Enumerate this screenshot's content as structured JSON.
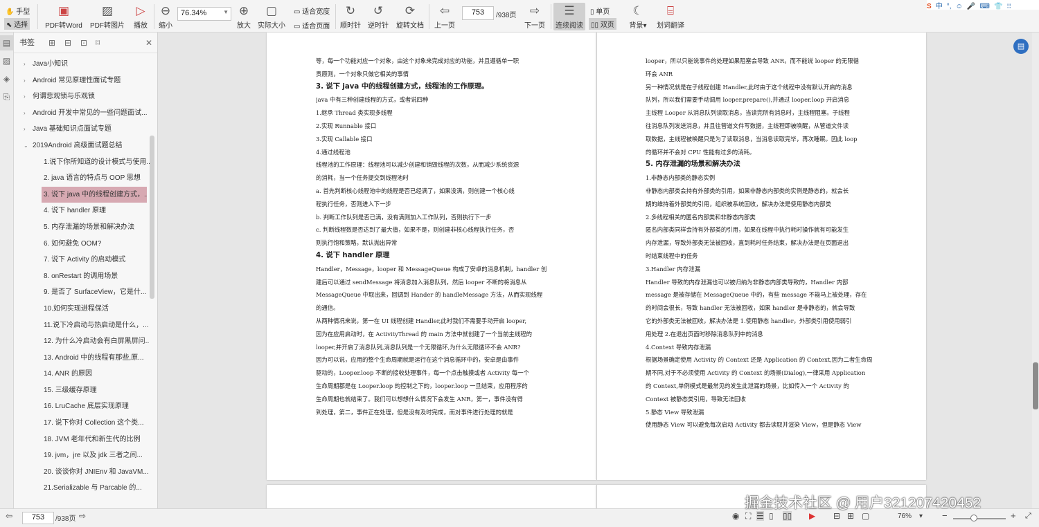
{
  "toolbar": {
    "hand_label": "手型",
    "select_label": "选择",
    "pdf_to_word": "PDF转Word",
    "pdf_to_image": "PDF转图片",
    "play": "播放",
    "zoom_out": "缩小",
    "zoom_value": "76.34%",
    "zoom_in": "放大",
    "actual_size": "实际大小",
    "fit_width": "适合宽度",
    "fit_page": "适合页面",
    "rotate_cw": "顺时针",
    "rotate_ccw": "逆时针",
    "rotate_doc": "旋转文档",
    "prev_page": "上一页",
    "page_current": "753",
    "page_total": "/938页",
    "next_page": "下一页",
    "continuous": "连续阅读",
    "single": "单页",
    "double": "双页",
    "background": "背景",
    "translate": "划词翻译"
  },
  "tray": [
    "中",
    "°,",
    "☺",
    "🎤",
    "⌨",
    "👕",
    "⁝⁝"
  ],
  "sidebar": {
    "title": "书签",
    "items": [
      {
        "label": "Java小知识",
        "level": 0
      },
      {
        "label": "Android 常见原理性面试专题",
        "level": 0
      },
      {
        "label": "何谓悲观锁与乐观锁",
        "level": 0
      },
      {
        "label": "Android 开发中常见的一些问题面试...",
        "level": 0
      },
      {
        "label": "Java 基础知识点面试专题",
        "level": 0
      },
      {
        "label": "2019Android 高级面试题总结",
        "level": 0
      },
      {
        "label": "1.说下你所知道的设计模式与使用...",
        "level": 1
      },
      {
        "label": "2. java 语言的特点与 OOP 思想",
        "level": 1
      },
      {
        "label": "3. 说下 java 中的线程创建方式，...",
        "level": 1,
        "selected": true
      },
      {
        "label": "4. 说下 handler 原理",
        "level": 1
      },
      {
        "label": "5. 内存泄漏的场景和解决办法",
        "level": 1
      },
      {
        "label": "6. 如何避免 OOM?",
        "level": 1
      },
      {
        "label": "7. 说下 Activity 的启动模式",
        "level": 1
      },
      {
        "label": "8. onRestart 的调用场景",
        "level": 1
      },
      {
        "label": "9. 是否了 SurfaceView，它是什...",
        "level": 1
      },
      {
        "label": "10.如何实现进程保活",
        "level": 1
      },
      {
        "label": "11.说下冷启动与热启动是什么，...",
        "level": 1
      },
      {
        "label": "12. 为什么冷启动会有白屏黑屏问...",
        "level": 1
      },
      {
        "label": "13. Android 中的线程有那些,原...",
        "level": 1
      },
      {
        "label": "14. ANR 的原因",
        "level": 1
      },
      {
        "label": "15. 三级缓存原理",
        "level": 1
      },
      {
        "label": "16. LruCache 底层实现原理",
        "level": 1
      },
      {
        "label": "17. 说下你对 Collection 这个类...",
        "level": 1
      },
      {
        "label": "18. JVM 老年代和新生代的比例",
        "level": 1
      },
      {
        "label": "19. jvm，jre 以及 jdk 三者之间...",
        "level": 1
      },
      {
        "label": "20. 谈谈你对 JNIEnv 和 JavaVM...",
        "level": 1
      },
      {
        "label": "21.Serializable 与 Parcable 的...",
        "level": 1
      }
    ]
  },
  "page_left": [
    {
      "t": "等，每一个功能对应一个对象，由这个对象来完成对应的功能，并且遵循单一职",
      "h": false
    },
    {
      "t": "责原则，一个对象只做它相关的事情",
      "h": false
    },
    {
      "t": "3.  说下 java 中的线程创建方式，线程池的工作原理。",
      "h": true
    },
    {
      "t": "java 中有三种创建线程的方式，或者说四种",
      "h": false
    },
    {
      "t": "1.继承 Thread 类实现多线程",
      "h": false
    },
    {
      "t": "2.实现 Runnable 接口",
      "h": false
    },
    {
      "t": "3.实现 Callable 接口",
      "h": false
    },
    {
      "t": "4.通过线程池",
      "h": false
    },
    {
      "t": "线程池的工作原理：线程池可以减少创建和销毁线程的次数，从而减少系统资源",
      "h": false
    },
    {
      "t": "的消耗，当一个任务提交到线程池时",
      "h": false
    },
    {
      "t": "a. 首先判断核心线程池中的线程是否已经满了，如果没满，则创建一个核心线",
      "h": false
    },
    {
      "t": "程执行任务，否则进入下一步",
      "h": false
    },
    {
      "t": "b. 判断工作队列是否已满，没有满则加入工作队列，否则执行下一步",
      "h": false
    },
    {
      "t": "c. 判断线程数是否达到了最大值，如果不是，则创建非核心线程执行任务，否",
      "h": false
    },
    {
      "t": "则执行饱和策略，默认抛出异常",
      "h": false
    },
    {
      "t": "4.  说下 handler 原理",
      "h": true
    },
    {
      "t": "Handler，Message，looper 和 MessageQueue 构成了安卓的消息机制，handler 创",
      "h": false
    },
    {
      "t": "建后可以通过 sendMessage 将消息加入消息队列，然后 looper 不断的将消息从",
      "h": false
    },
    {
      "t": "MessageQueue 中取出来，回调到 Hander 的 handleMessage 方法，从而实现线程",
      "h": false
    },
    {
      "t": "的通信。",
      "h": false
    },
    {
      "t": "从两种情况来说，第一在 UI 线程创建 Handler,此时我们不需要手动开启 looper,",
      "h": false
    },
    {
      "t": "因为在应用启动时，在 ActivityThread 的 main 方法中就创建了一个当前主线程的",
      "h": false
    },
    {
      "t": "looper,并开启了消息队列,消息队列是一个无限循环,为什么无限循环不会 ANR?",
      "h": false
    },
    {
      "t": "因为可以说，应用的整个生命周期就是运行在这个消息循环中的，安卓是由事件",
      "h": false
    },
    {
      "t": "驱动的，Looper.loop 不断的接收处理事件，每一个点击触摸或者 Activity 每一个",
      "h": false
    },
    {
      "t": "生命周期都是在 Looper.loop 的控制之下的，looper.loop 一旦结束，应用程序的",
      "h": false
    },
    {
      "t": "生命周期也就结束了。我们可以想想什么情况下会发生 ANR，第一，事件没有得",
      "h": false
    },
    {
      "t": "到处理，第二，事件正在处理，但是没有及时完成，而对事件进行处理的就是",
      "h": false
    }
  ],
  "page_right": [
    {
      "t": "looper，所以只能说事件的处理如果阻塞会导致 ANR，而不能说 looper 的无限循",
      "h": false
    },
    {
      "t": "环会 ANR",
      "h": false
    },
    {
      "t": "另一种情况就是在子线程创建 Handler,此时由于这个线程中没有默认开启的消息",
      "h": false
    },
    {
      "t": "队列，所以我们需要手动调用 looper.prepare(),并通过 looper.loop 开启消息",
      "h": false
    },
    {
      "t": "主线程 Looper 从消息队列读取消息，当读完所有消息时，主线程阻塞。子线程",
      "h": false
    },
    {
      "t": "往消息队列发送消息，并且往管道文件写数据，主线程即被唤醒，从管道文件读",
      "h": false
    },
    {
      "t": "取数据，主线程被唤醒只是为了读取消息，当消息读取完毕，再次睡眠。因此 loop",
      "h": false
    },
    {
      "t": "的循环并不会对 CPU 性能有过多的消耗。",
      "h": false
    },
    {
      "t": "5.  内存泄漏的场景和解决办法",
      "h": true
    },
    {
      "t": "1.非静态内部类的静态实例",
      "h": false
    },
    {
      "t": "非静态内部类会持有外部类的引用，如果非静态内部类的实例是静态的，就会长",
      "h": false
    },
    {
      "t": "期的维持着外部类的引用，组织被系统回收，解决办法是使用静态内部类",
      "h": false
    },
    {
      "t": "2.多线程相关的匿名内部类和非静态内部类",
      "h": false
    },
    {
      "t": "匿名内部类同样会持有外部类的引用，如果在线程中执行耗时操作就有可能发生",
      "h": false
    },
    {
      "t": "内存泄漏，导致外部类无法被回收，直到耗时任务结束，解决办法是在页面退出",
      "h": false
    },
    {
      "t": "时结束线程中的任务",
      "h": false
    },
    {
      "t": "3.Handler 内存泄漏",
      "h": false
    },
    {
      "t": "Handler 导致的内存泄漏也可以被归纳为非静态内部类导致的，Handler 内部",
      "h": false
    },
    {
      "t": "message 是被存储在 MessageQueue 中的，有些 message 不能马上被处理，存在",
      "h": false
    },
    {
      "t": "的时间会很长，导致 handler 无法被回收，如果 handler 是非静态的，就会导致",
      "h": false
    },
    {
      "t": "它的外部类无法被回收，解决办法是 1.使用静态 handler，外部类引用使用弱引",
      "h": false
    },
    {
      "t": "用处理 2.在退出页面时移除消息队列中的消息",
      "h": false
    },
    {
      "t": "4.Context 导致内存泄漏",
      "h": false
    },
    {
      "t": "根据场景确定使用 Activity 的 Context 还是 Application 的 Context,因为二者生命周",
      "h": false
    },
    {
      "t": "期不同,对于不必须使用 Activity 的 Context 的场景(Dialog),一律采用 Application",
      "h": false
    },
    {
      "t": "的 Context,单例模式是最常见的发生此泄漏的场景，比如传入一个 Activity 的",
      "h": false
    },
    {
      "t": "Context 被静态类引用，导致无法回收",
      "h": false
    },
    {
      "t": "5.静态 View 导致泄漏",
      "h": false
    },
    {
      "t": "使用静态 View 可以避免每次启动 Activity 都去读取并渲染 View，但是静态 View",
      "h": false
    }
  ],
  "status": {
    "page_current": "753",
    "page_total": "/938页",
    "zoom": "76%"
  },
  "watermark": "掘金技术社区 @ 用户3212074204​52"
}
